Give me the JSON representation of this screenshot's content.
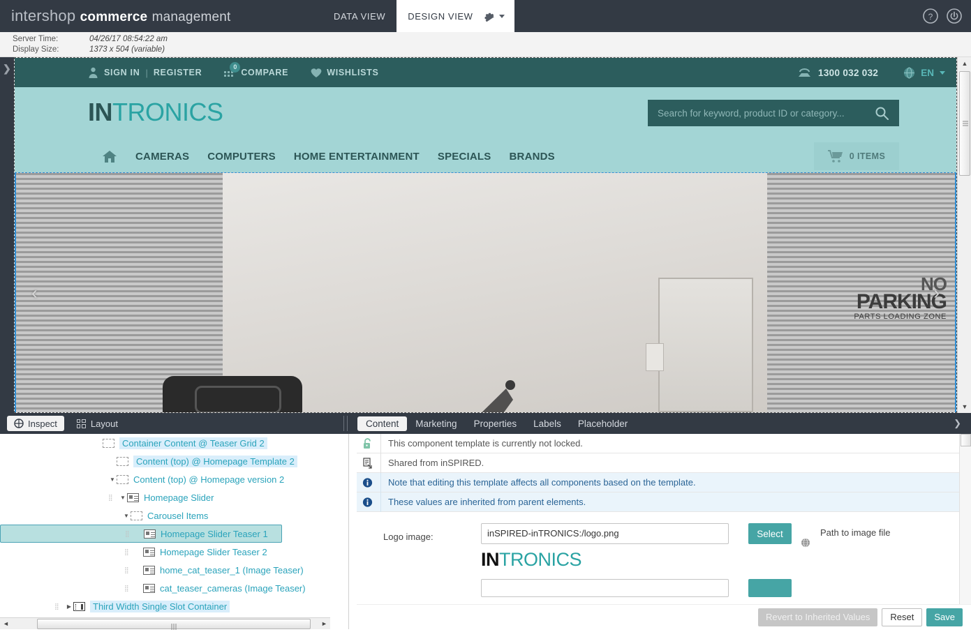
{
  "app": {
    "brand_light": "intershop",
    "brand_bold": "commerce",
    "brand_normal": "management",
    "nav": [
      {
        "label": "DATA VIEW",
        "active": false
      },
      {
        "label": "DESIGN VIEW",
        "active": true
      }
    ],
    "gear_icon": "gear-icon",
    "help_icon": "help-circle-icon",
    "power_icon": "power-circle-icon"
  },
  "info_bar": {
    "server_time_label": "Server Time:",
    "server_time_value": "04/26/17 08:54:22 am",
    "display_size_label": "Display Size:",
    "display_size_value": "1373 x 504 (variable)"
  },
  "left_rail": {
    "expand_icon": "chevron-right-icon"
  },
  "storefront": {
    "utility": {
      "sign_in": "SIGN IN",
      "separator": "|",
      "register": "REGISTER",
      "compare": "COMPARE",
      "compare_count": "0",
      "wishlists": "WISHLISTS",
      "phone": "1300 032 032",
      "language": "EN"
    },
    "logo": {
      "part1": "IN",
      "part2": "TRONICS"
    },
    "search_placeholder": "Search for keyword, product ID or category...",
    "nav_items": [
      "CAMERAS",
      "COMPUTERS",
      "HOME ENTERTAINMENT",
      "SPECIALS",
      "BRANDS"
    ],
    "cart_label": "0 ITEMS",
    "hero": {
      "sign_line1": "NO",
      "sign_line2": "PARKING",
      "sign_line3": "PARTS LOADING ZONE",
      "prev_arrow": "‹",
      "next_arrow": "›"
    }
  },
  "toolbar": {
    "inspect_label": "Inspect",
    "layout_label": "Layout",
    "tabs": [
      {
        "label": "Content",
        "active": true
      },
      {
        "label": "Marketing",
        "active": false
      },
      {
        "label": "Properties",
        "active": false
      },
      {
        "label": "Labels",
        "active": false
      },
      {
        "label": "Placeholder",
        "active": false
      }
    ],
    "collapse_icon": "chevron-down-icon"
  },
  "tree": {
    "rows": [
      {
        "label": "Container Content @ Teaser Grid 2",
        "indent": 135,
        "twisty": "",
        "icon": "dashed",
        "highlight": true,
        "selected": false,
        "handle": false
      },
      {
        "label": "Content (top) @ Homepage Template 2",
        "indent": 155,
        "twisty": "",
        "icon": "dashed",
        "highlight": true,
        "selected": false,
        "handle": false
      },
      {
        "label": "Content (top) @ Homepage version 2",
        "indent": 155,
        "twisty": "▼",
        "icon": "dashed",
        "highlight": false,
        "selected": false,
        "handle": false
      },
      {
        "label": "Homepage Slider",
        "indent": 155,
        "twisty": "▼",
        "icon": "comp",
        "highlight": false,
        "selected": false,
        "handle": true
      },
      {
        "label": "Carousel Items",
        "indent": 175,
        "twisty": "▼",
        "icon": "dashed",
        "highlight": false,
        "selected": false,
        "handle": false
      },
      {
        "label": "Homepage Slider Teaser 1",
        "indent": 178,
        "twisty": "",
        "icon": "comp",
        "highlight": false,
        "selected": true,
        "handle": true
      },
      {
        "label": "Homepage Slider Teaser 2",
        "indent": 178,
        "twisty": "",
        "icon": "comp",
        "highlight": false,
        "selected": false,
        "handle": true
      },
      {
        "label": "home_cat_teaser_1 (Image Teaser)",
        "indent": 178,
        "twisty": "",
        "icon": "comp",
        "highlight": false,
        "selected": false,
        "handle": true
      },
      {
        "label": "cat_teaser_cameras (Image Teaser)",
        "indent": 178,
        "twisty": "",
        "icon": "comp",
        "highlight": false,
        "selected": false,
        "handle": true
      },
      {
        "label": "Third Width Single Slot Container",
        "indent": 78,
        "twisty": "▶",
        "icon": "slot",
        "highlight": true,
        "selected": false,
        "handle": true
      }
    ]
  },
  "properties": {
    "messages": [
      {
        "text": "This component template is currently not locked.",
        "icon": "unlock-icon",
        "type": "plain"
      },
      {
        "text": "Shared from inSPIRED.",
        "icon": "shared-icon",
        "type": "plain"
      },
      {
        "text": "Note that editing this template affects all components based on the template.",
        "icon": "info-icon",
        "type": "info"
      },
      {
        "text": "These values are inherited from parent elements.",
        "icon": "info-icon",
        "type": "info"
      }
    ],
    "logo_field": {
      "label": "Logo image:",
      "value": "inSPIRED-inTRONICS:/logo.png",
      "select_label": "Select",
      "hint": "Path to image file",
      "globe_icon": "globe-icon",
      "preview_part1": "IN",
      "preview_part2": "TRONICS"
    },
    "footer": {
      "revert_label": "Revert to Inherited Values",
      "reset_label": "Reset",
      "save_label": "Save"
    }
  },
  "colors": {
    "app_bar": "#333a44",
    "teal_dark": "#2c5d5d",
    "teal_light": "#a3d5d5",
    "accent": "#46a5a5",
    "tree_link": "#2aa3bb",
    "info_blue": "#2a6496"
  }
}
